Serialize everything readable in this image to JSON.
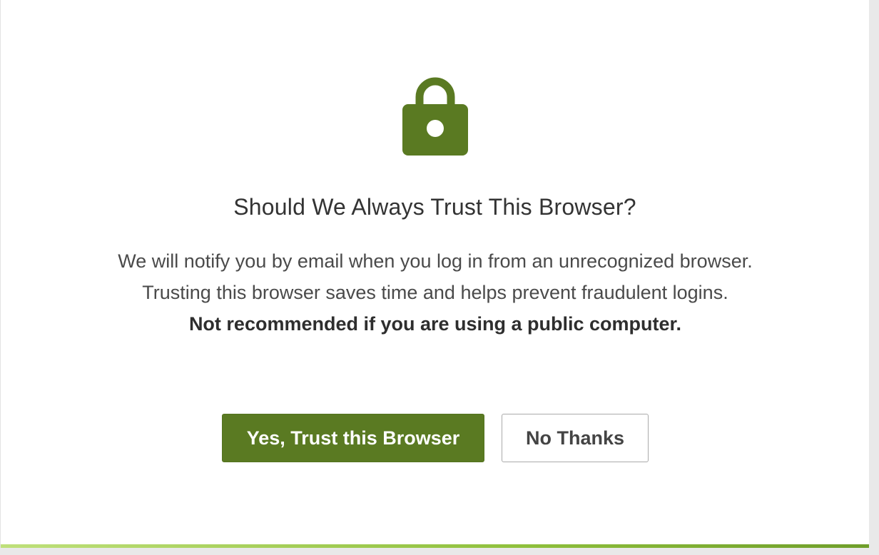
{
  "dialog": {
    "title": "Should We Always Trust This Browser?",
    "message_lines": [
      "We will notify you by email when you log in from an unrecognized browser.",
      "Trusting this browser saves time and helps prevent fraudulent logins."
    ],
    "warning": "Not recommended if you are using a public computer.",
    "icon": "lock-icon",
    "buttons": {
      "yes_label": "Yes, Trust this Browser",
      "no_label": "No Thanks"
    }
  },
  "colors": {
    "accent": "#5a7a22",
    "lock": "#5a7a22",
    "accent_bar": "#8fc03c"
  }
}
